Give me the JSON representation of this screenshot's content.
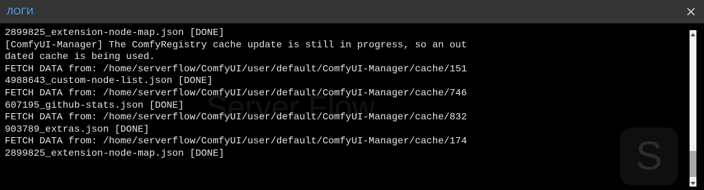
{
  "window": {
    "title": "ЛОГИ",
    "close_icon": "close-icon"
  },
  "log": {
    "lines": [
      "2899825_extension-node-map.json [DONE]",
      "[ComfyUI-Manager] The ComfyRegistry cache update is still in progress, so an out",
      "dated cache is being used.",
      "FETCH DATA from: /home/serverflow/ComfyUI/user/default/ComfyUI-Manager/cache/151",
      "4988643_custom-node-list.json [DONE]",
      "FETCH DATA from: /home/serverflow/ComfyUI/user/default/ComfyUI-Manager/cache/746",
      "607195_github-stats.json [DONE]",
      "FETCH DATA from: /home/serverflow/ComfyUI/user/default/ComfyUI-Manager/cache/832",
      "903789_extras.json [DONE]",
      "FETCH DATA from: /home/serverflow/ComfyUI/user/default/ComfyUI-Manager/cache/174",
      "2899825_extension-node-map.json [DONE]"
    ]
  },
  "watermark": {
    "text": "Server Flow",
    "logo_letter": "S"
  },
  "colors": {
    "title": "#5aa9ff",
    "background": "#353535",
    "console": "#000000",
    "text": "#e6e6e6"
  }
}
